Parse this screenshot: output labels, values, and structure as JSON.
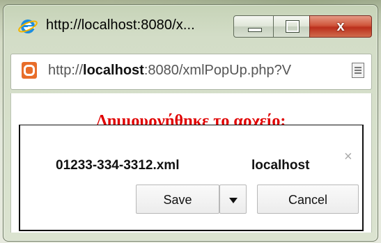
{
  "window": {
    "title": "http://localhost:8080/x...",
    "controls": {
      "minimize_icon": "minimize-icon",
      "maximize_icon": "maximize-icon",
      "close_label": "x"
    }
  },
  "address_bar": {
    "favicon": "orange-favicon-icon",
    "url_prefix": "http://",
    "url_host": "localhost",
    "url_rest": ":8080/xmlPopUp.php?V",
    "page_icon": "document-icon"
  },
  "page": {
    "heading": "Δημιουργήθηκε το αρχείο:"
  },
  "download_dialog": {
    "accent_color": "#e6a400",
    "file_name": "01233-334-3312.xml",
    "source": "localhost",
    "close_label": "×",
    "save_label": "Save",
    "cancel_label": "Cancel"
  }
}
